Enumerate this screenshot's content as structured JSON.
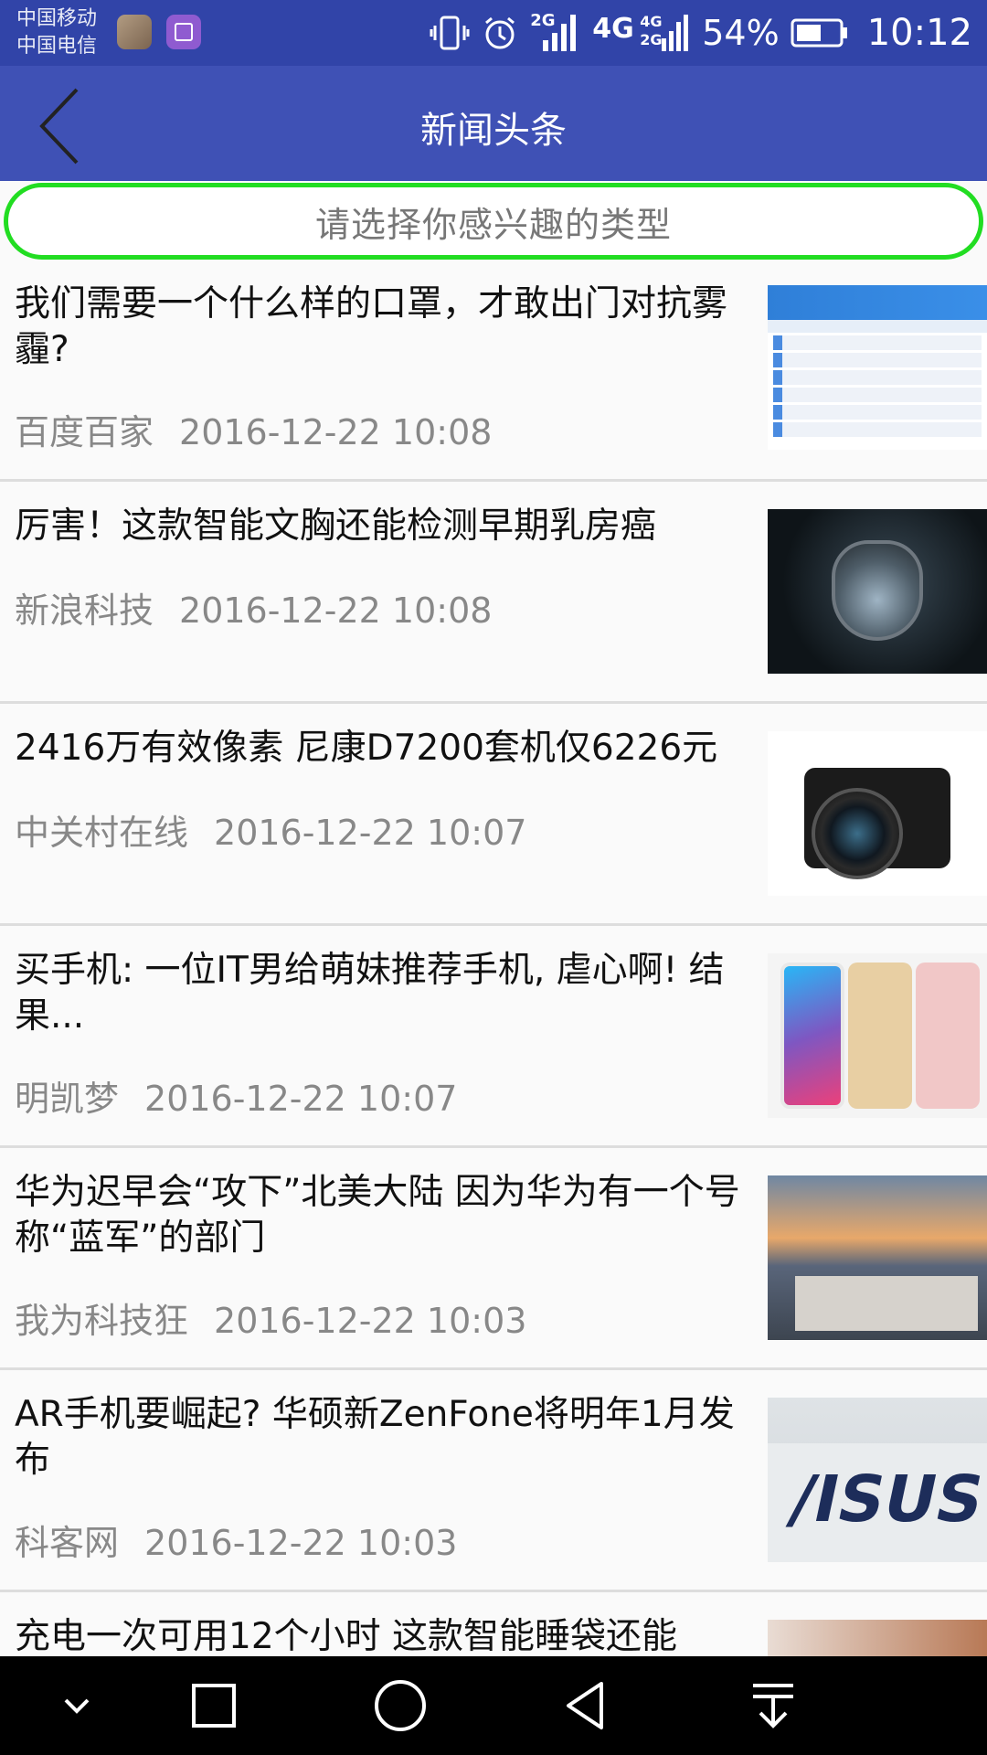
{
  "status_bar": {
    "carrier_1": "中国移动",
    "carrier_2": "中国电信",
    "network_1": "2G",
    "network_2": "4G",
    "network_3_top": "4G",
    "network_3_bottom": "2G",
    "battery": "54%",
    "time": "10:12"
  },
  "app_bar": {
    "title": "新闻头条",
    "back_icon": "chevron-left-icon"
  },
  "category": {
    "label": "请选择你感兴趣的类型",
    "border_color": "#22dd22"
  },
  "news": [
    {
      "title": "我们需要一个什么样的口罩，才敢出门对抗雾霾?",
      "source": "百度百家",
      "time": "2016-12-22 10:08"
    },
    {
      "title": "厉害！这款智能文胸还能检测早期乳房癌",
      "source": "新浪科技",
      "time": "2016-12-22 10:08"
    },
    {
      "title": "2416万有效像素 尼康D7200套机仅6226元",
      "source": "中关村在线",
      "time": "2016-12-22 10:07"
    },
    {
      "title": "买手机: 一位IT男给萌妹推荐手机, 虐心啊! 结果...",
      "source": "明凯梦",
      "time": "2016-12-22 10:07"
    },
    {
      "title": "华为迟早会“攻下”北美大陆 因为华为有一个号称“蓝军”的部门",
      "source": "我为科技狂",
      "time": "2016-12-22 10:03"
    },
    {
      "title": "AR手机要崛起? 华硕新ZenFone将明年1月发布",
      "source": "科客网",
      "time": "2016-12-22 10:03"
    },
    {
      "title": "充电一次可用12个小时 这款智能睡袋还能",
      "source": "",
      "time": ""
    }
  ],
  "thumb_text": {
    "asus_logo": "/ISUS"
  },
  "colors": {
    "status_bar": "#3144a8",
    "app_bar": "#3f51b5",
    "nav_bar": "#000000"
  },
  "nav": [
    "chevron-down-icon",
    "square-icon",
    "circle-icon",
    "triangle-back-icon",
    "pull-down-icon"
  ]
}
